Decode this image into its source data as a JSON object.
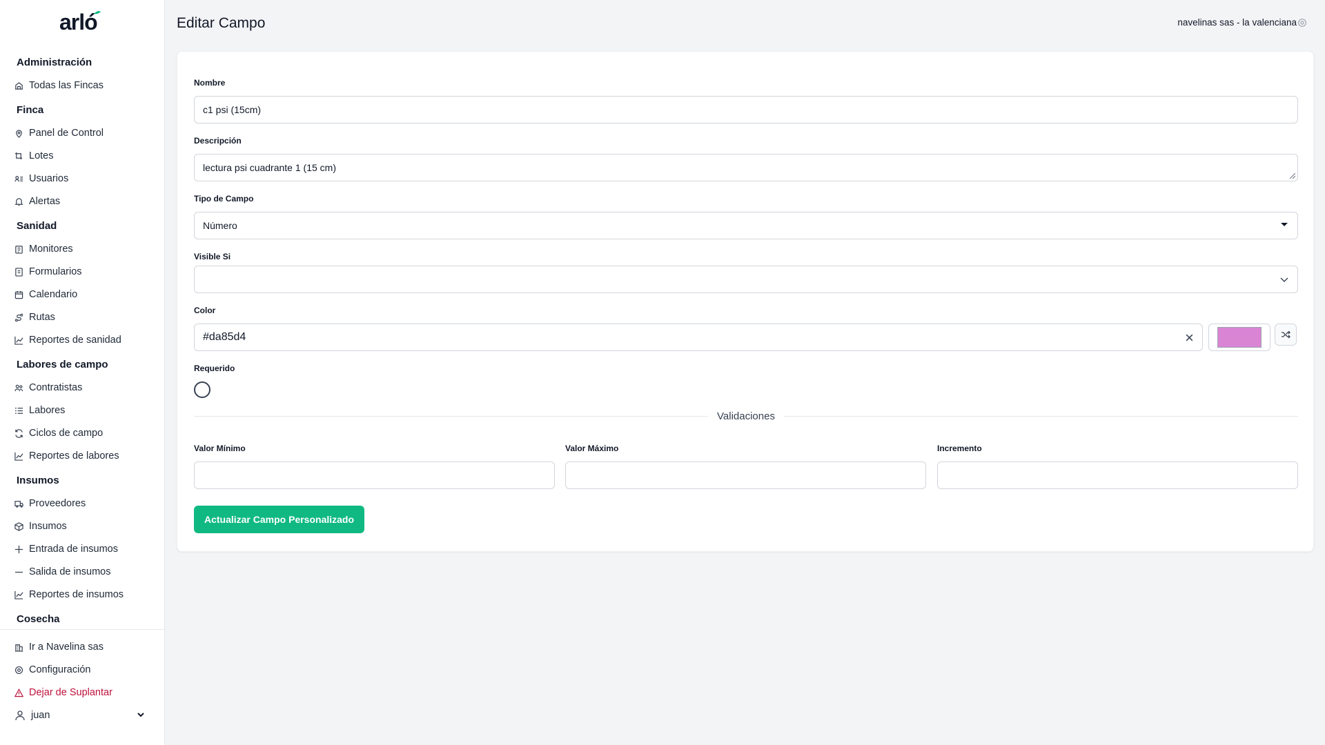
{
  "app": {
    "logo_text": "arló",
    "brand_color": "#10b981"
  },
  "header": {
    "title": "Editar Campo",
    "tenant": "navelinas sas - la valenciana"
  },
  "sidebar": {
    "sections": [
      {
        "title": "Administración",
        "items": [
          {
            "label": "Todas las Fincas",
            "icon": "farm-icon"
          }
        ]
      },
      {
        "title": "Finca",
        "items": [
          {
            "label": "Panel de Control",
            "icon": "map-pin-icon"
          },
          {
            "label": "Lotes",
            "icon": "crop-icon"
          },
          {
            "label": "Usuarios",
            "icon": "users-list-icon"
          },
          {
            "label": "Alertas",
            "icon": "bell-icon"
          }
        ]
      },
      {
        "title": "Sanidad",
        "items": [
          {
            "label": "Monitores",
            "icon": "clipboard-icon"
          },
          {
            "label": "Formularios",
            "icon": "form-icon"
          },
          {
            "label": "Calendario",
            "icon": "calendar-icon"
          },
          {
            "label": "Rutas",
            "icon": "route-icon"
          },
          {
            "label": "Reportes de sanidad",
            "icon": "chart-line-icon"
          }
        ]
      },
      {
        "title": "Labores de campo",
        "items": [
          {
            "label": "Contratistas",
            "icon": "people-icon"
          },
          {
            "label": "Labores",
            "icon": "list-icon"
          },
          {
            "label": "Ciclos de campo",
            "icon": "refresh-icon"
          },
          {
            "label": "Reportes de labores",
            "icon": "chart-line-icon"
          }
        ]
      },
      {
        "title": "Insumos",
        "items": [
          {
            "label": "Proveedores",
            "icon": "truck-icon"
          },
          {
            "label": "Insumos",
            "icon": "package-icon"
          },
          {
            "label": "Entrada de insumos",
            "icon": "plus-icon"
          },
          {
            "label": "Salida de insumos",
            "icon": "minus-icon"
          },
          {
            "label": "Reportes de insumos",
            "icon": "chart-line-icon"
          }
        ]
      },
      {
        "title": "Cosecha",
        "items": []
      }
    ],
    "bottom": {
      "switch_label": "Ir a Navelina sas",
      "settings_label": "Configuración",
      "impersonate_label": "Dejar de Suplantar",
      "user_name": "juan"
    },
    "danger_color": "#be123c"
  },
  "form": {
    "name": {
      "label": "Nombre",
      "value": "c1 psi (15cm)"
    },
    "description": {
      "label": "Descripción",
      "value": "lectura psi cuadrante 1 (15 cm)"
    },
    "field_type": {
      "label": "Tipo de Campo",
      "value": "Número"
    },
    "visible_if": {
      "label": "Visible Si",
      "value": ""
    },
    "color": {
      "label": "Color",
      "value": "#da85d4",
      "swatch_color": "#da85d4"
    },
    "required": {
      "label": "Requerido",
      "checked": false
    },
    "validations_title": "Validaciones",
    "min": {
      "label": "Valor Mínimo",
      "value": ""
    },
    "max": {
      "label": "Valor Máximo",
      "value": ""
    },
    "step": {
      "label": "Incremento",
      "value": ""
    },
    "submit_label": "Actualizar Campo Personalizado"
  }
}
